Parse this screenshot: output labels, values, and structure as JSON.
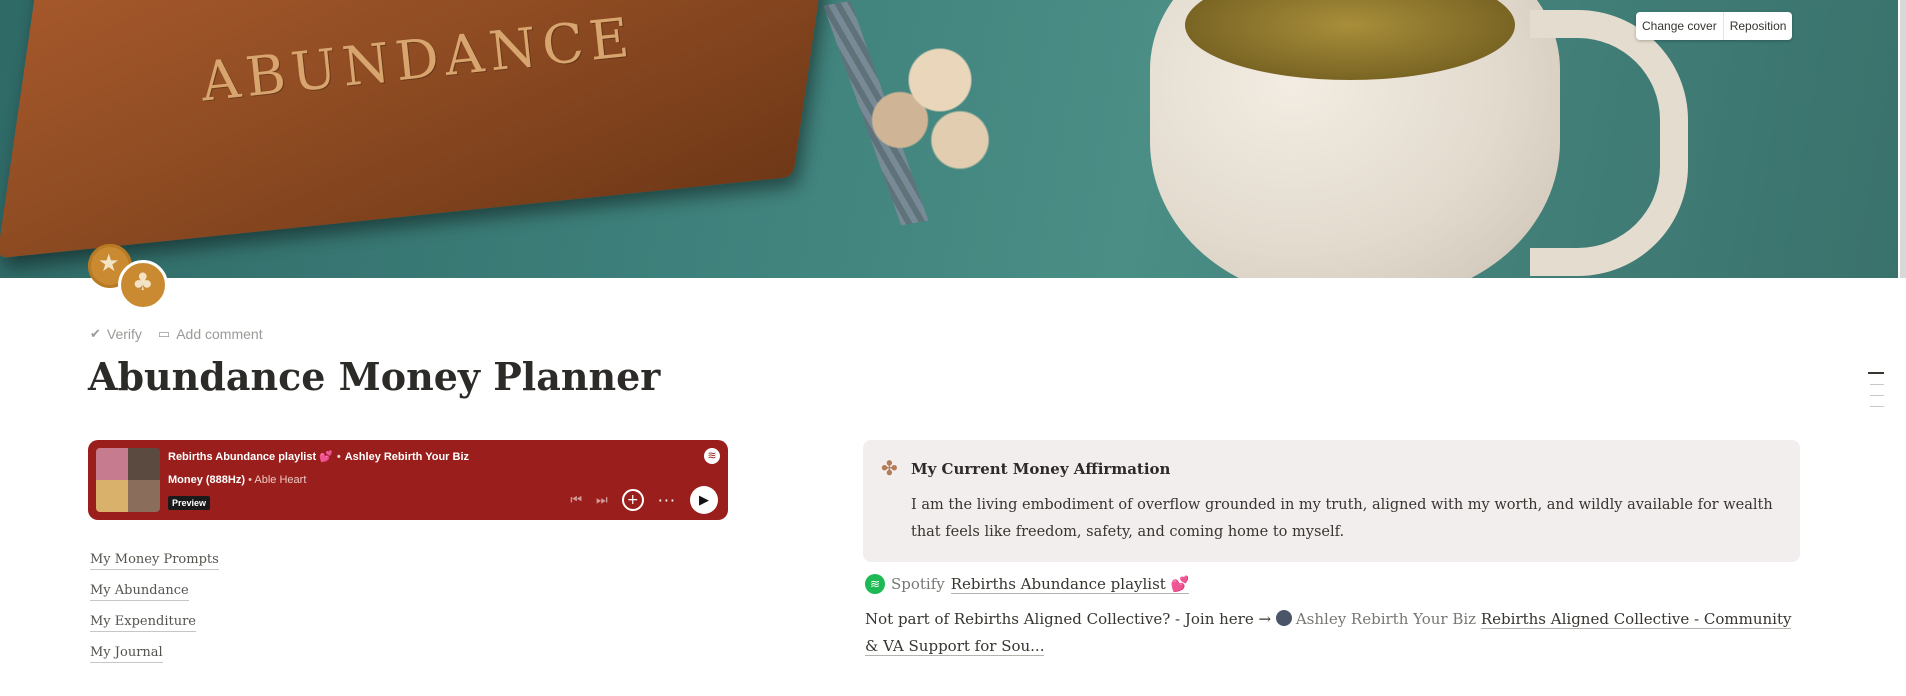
{
  "cover": {
    "book_text": "ABUNDANCE",
    "change_cover_label": "Change cover",
    "reposition_label": "Reposition"
  },
  "meta": {
    "verify_label": "Verify",
    "add_comment_label": "Add comment"
  },
  "page": {
    "title": "Abundance Money Planner"
  },
  "spotify_embed": {
    "playlist_title": "Rebirths Abundance playlist 💕",
    "separator": "•",
    "owner": "Ashley Rebirth Your Biz",
    "track_title": "Money (888Hz)",
    "track_artist": "Able Heart",
    "preview_label": "Preview",
    "accent_color": "#9a1f1c"
  },
  "links": [
    {
      "label": "My Money Prompts"
    },
    {
      "label": "My Abundance"
    },
    {
      "label": "My Expenditure"
    },
    {
      "label": "My Journal"
    }
  ],
  "callout": {
    "icon": "clover-icon",
    "heading": "My Current Money Affirmation",
    "body": "I am the living embodiment of overflow grounded in my truth, aligned with my worth, and wildly available for wealth that feels like freedom, safety, and coming home to myself."
  },
  "spotify_link": {
    "source": "Spotify",
    "title": "Rebirths Abundance playlist 💕"
  },
  "join_line": {
    "prefix": "Not part of Rebirths Aligned Collective? - Join here →",
    "mention": "Ashley Rebirth Your Biz",
    "link": "Rebirths Aligned Collective - Community & VA Support for Sou..."
  }
}
